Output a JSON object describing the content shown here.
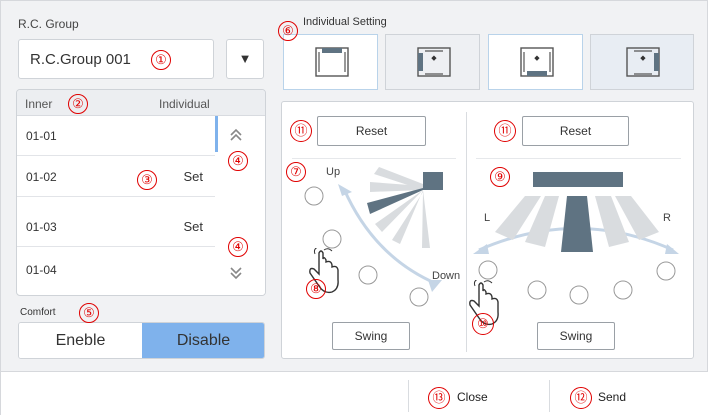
{
  "group": {
    "label": "R.C. Group",
    "selected": "R.C.Group 001",
    "dropdown_glyph": "▼"
  },
  "indoor_list": {
    "col_inner": "Inner",
    "col_individual": "Individual",
    "rows": [
      {
        "id": "01-01",
        "status": ""
      },
      {
        "id": "01-02",
        "status": "Set"
      },
      {
        "id": "01-03",
        "status": "Set"
      },
      {
        "id": "01-04",
        "status": ""
      }
    ],
    "scroll_up_icon": "chevron-double-up-icon",
    "scroll_down_icon": "chevron-double-down-icon"
  },
  "comfort": {
    "label": "Comfort",
    "enable": "Eneble",
    "disable": "Disable",
    "selected": "Disable",
    "accent": "#7fb2ec"
  },
  "individual_setting": {
    "label": "Individual Setting",
    "selected_tab": 0
  },
  "vertical": {
    "reset": "Reset",
    "up": "Up",
    "down": "Down",
    "swing": "Swing"
  },
  "horizontal": {
    "reset": "Reset",
    "left": "L",
    "right": "R",
    "swing": "Swing"
  },
  "footer": {
    "close": "Close",
    "send": "Send"
  },
  "callouts": {
    "c1": "①",
    "c2": "②",
    "c3": "③",
    "c4a": "④",
    "c4b": "④",
    "c5": "⑤",
    "c6": "⑥",
    "c7": "⑦",
    "c8": "⑧",
    "c9": "⑨",
    "c10": "⑩",
    "c11a": "⑪",
    "c11b": "⑪",
    "c12": "⑫",
    "c13": "⑬"
  },
  "colors": {
    "callout": "#e00000",
    "vane_dark": "#5f7382",
    "vane_light": "#d9dcdf",
    "arc": "#c5d5e6"
  }
}
